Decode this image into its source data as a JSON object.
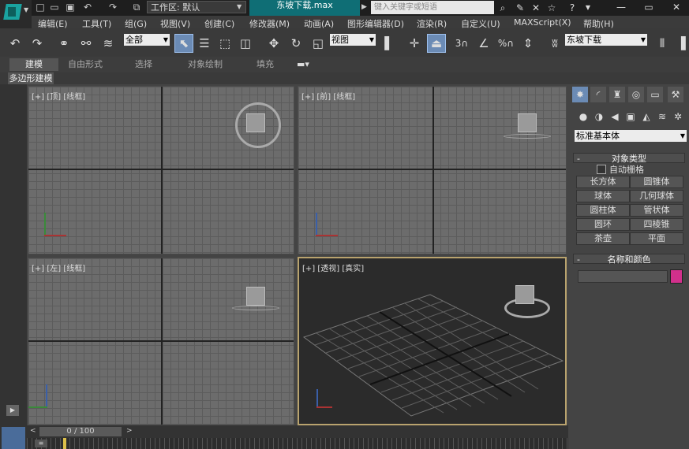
{
  "titlebar": {
    "workspace_label": "工作区: 默认",
    "file_title": "东坡下载.max",
    "search_placeholder": "键入关键字或短语",
    "help_label": "?"
  },
  "menubar": {
    "items": [
      "编辑(E)",
      "工具(T)",
      "组(G)",
      "视图(V)",
      "创建(C)",
      "修改器(M)",
      "动画(A)",
      "图形编辑器(D)",
      "渲染(R)",
      "自定义(U)",
      "MAXScript(X)",
      "帮助(H)"
    ]
  },
  "toolbar": {
    "selection_filter": "全部",
    "coord_system": "视图",
    "named_selection": "东坡下载",
    "snap_3": "3",
    "snap_percent": "%"
  },
  "ribbon": {
    "tabs": [
      "建模",
      "自由形式",
      "选择",
      "对象绘制",
      "填充"
    ],
    "active_panel": "多边形建模"
  },
  "viewports": {
    "top": {
      "plus": "[+]",
      "name": "[顶]",
      "shade": "[线框]"
    },
    "front": {
      "plus": "[+]",
      "name": "[前]",
      "shade": "[线框]"
    },
    "left": {
      "plus": "[+]",
      "name": "[左]",
      "shade": "[线框]"
    },
    "persp": {
      "plus": "[+]",
      "name": "[透视]",
      "shade": "[真实]"
    }
  },
  "command_panel": {
    "category_dropdown": "标准基本体",
    "object_type_title": "对象类型",
    "autogrid_label": "自动栅格",
    "object_buttons": [
      "长方体",
      "圆锥体",
      "球体",
      "几何球体",
      "圆柱体",
      "管状体",
      "圆环",
      "四棱锥",
      "茶壶",
      "平面"
    ],
    "name_color_title": "名称和颜色",
    "name_value": "",
    "object_color": "#d2308c"
  },
  "timeline": {
    "frame_readout": "0 / 100"
  },
  "colors": {
    "accent_title": "#0f6e75",
    "active_viewport_border": "#b9a36e",
    "active_tool": "#6b8bb5"
  }
}
